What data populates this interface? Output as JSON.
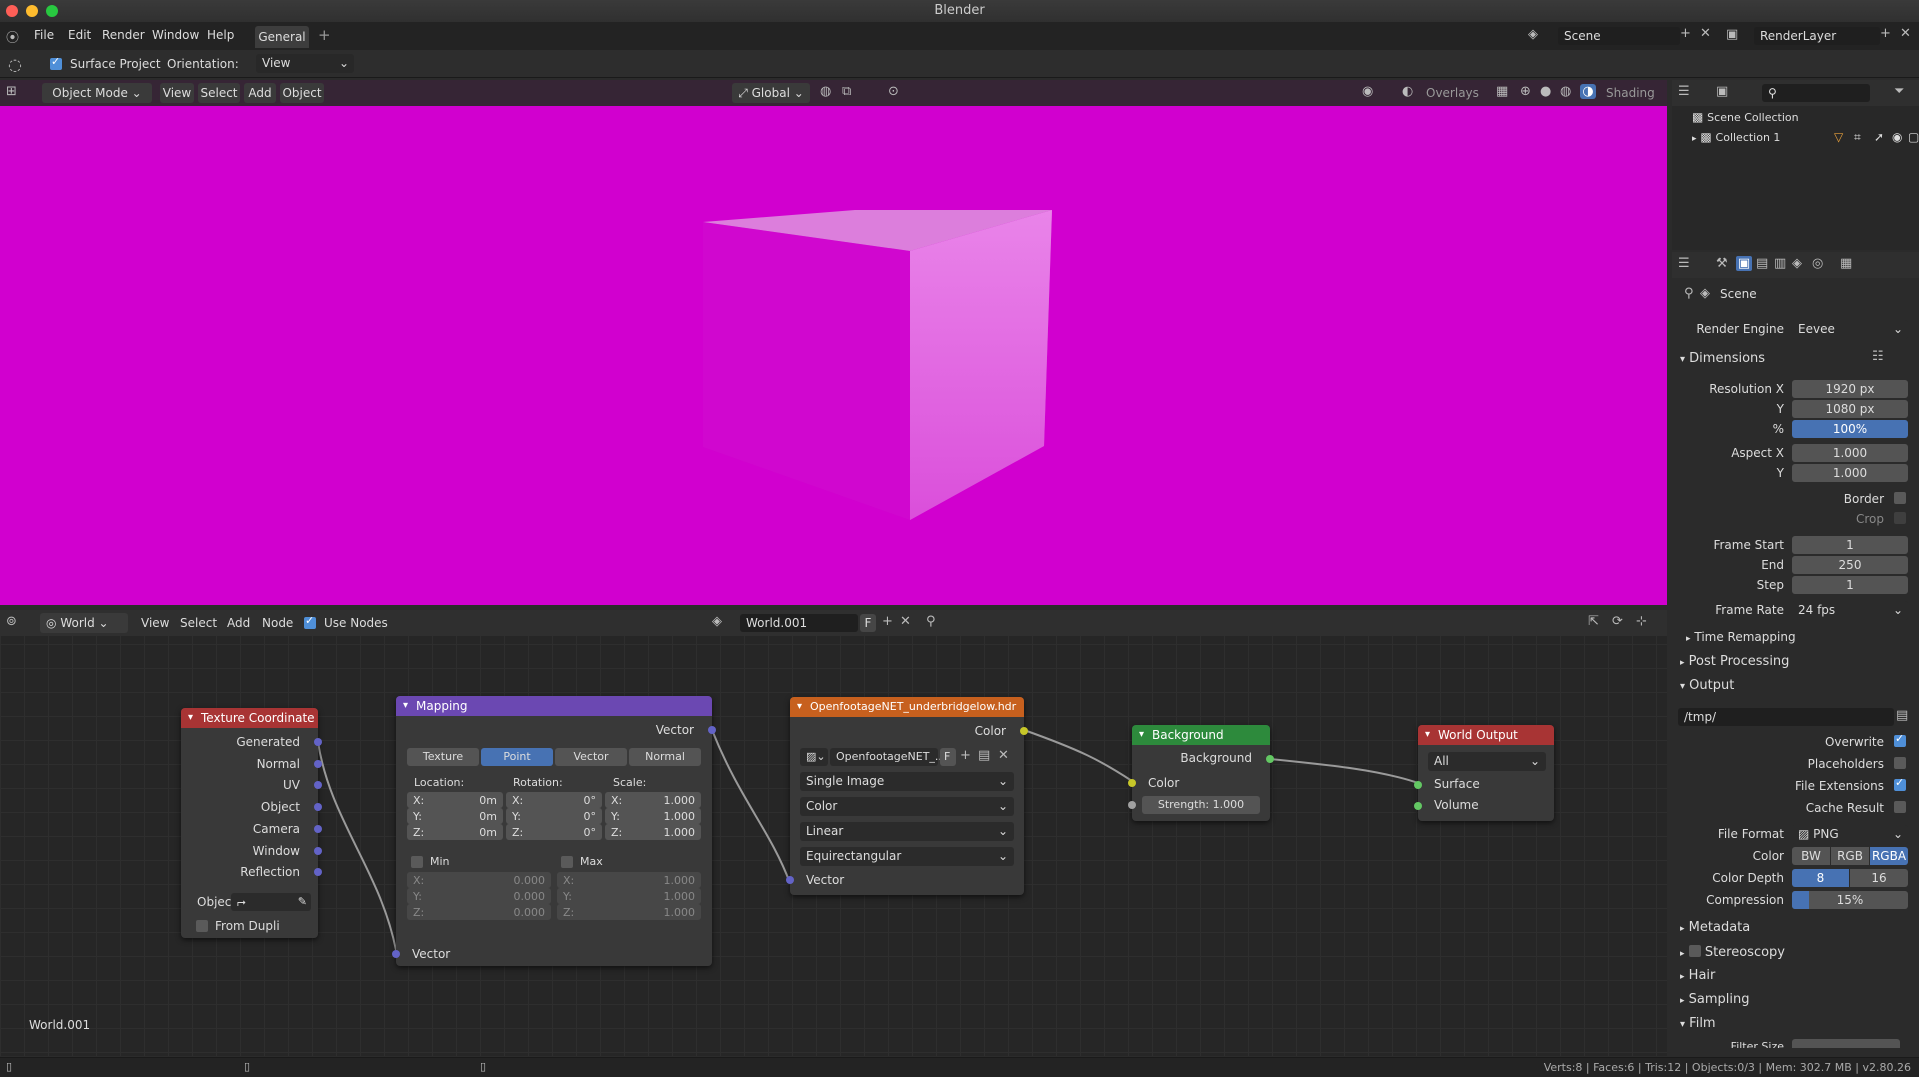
{
  "window": {
    "title": "Blender"
  },
  "menu": {
    "items": [
      "File",
      "Edit",
      "Render",
      "Window",
      "Help"
    ],
    "workspace_tab": "General",
    "add_tab": "+",
    "scene_name": "Scene",
    "layer_name": "RenderLayer"
  },
  "tool_options": {
    "surface_project": "Surface Project",
    "orientation_label": "Orientation:",
    "orientation_value": "View"
  },
  "viewport_header": {
    "mode": "Object Mode",
    "menus": [
      "View",
      "Select",
      "Add",
      "Object"
    ],
    "transform": "Global",
    "overlays": "Overlays",
    "shading": "Shading"
  },
  "node_header": {
    "type": "World",
    "menus": [
      "View",
      "Select",
      "Add",
      "Node"
    ],
    "use_nodes": "Use Nodes",
    "world_name": "World.001",
    "fake_user": "F"
  },
  "node_editor": {
    "world_label": "World.001"
  },
  "nodes": {
    "texcoord": {
      "title": "Texture Coordinate",
      "outputs": [
        "Generated",
        "Normal",
        "UV",
        "Object",
        "Camera",
        "Window",
        "Reflection"
      ],
      "object_label": "Objec",
      "from_dupli": "From Dupli"
    },
    "mapping": {
      "title": "Mapping",
      "output": "Vector",
      "tabs": [
        "Texture",
        "Point",
        "Vector",
        "Normal"
      ],
      "location_label": "Location:",
      "rotation_label": "Rotation:",
      "scale_label": "Scale:",
      "location": [
        {
          "axis": "X:",
          "value": "0m"
        },
        {
          "axis": "Y:",
          "value": "0m"
        },
        {
          "axis": "Z:",
          "value": "0m"
        }
      ],
      "rotation": [
        {
          "axis": "X:",
          "value": "0°"
        },
        {
          "axis": "Y:",
          "value": "0°"
        },
        {
          "axis": "Z:",
          "value": "0°"
        }
      ],
      "scale": [
        {
          "axis": "X:",
          "value": "1.000"
        },
        {
          "axis": "Y:",
          "value": "1.000"
        },
        {
          "axis": "Z:",
          "value": "1.000"
        }
      ],
      "min_label": "Min",
      "max_label": "Max",
      "min": [
        {
          "axis": "X:",
          "value": "0.000"
        },
        {
          "axis": "Y:",
          "value": "0.000"
        },
        {
          "axis": "Z:",
          "value": "0.000"
        }
      ],
      "max": [
        {
          "axis": "X:",
          "value": "1.000"
        },
        {
          "axis": "Y:",
          "value": "1.000"
        },
        {
          "axis": "Z:",
          "value": "1.000"
        }
      ],
      "input": "Vector"
    },
    "envtex": {
      "title": "OpenfootageNET_underbridgelow.hdr",
      "output": "Color",
      "image_name": "OpenfootageNET_...",
      "fake": "F",
      "source": "Single Image",
      "colorspace": "Color",
      "interpolation": "Linear",
      "projection": "Equirectangular",
      "input": "Vector"
    },
    "background": {
      "title": "Background",
      "output": "Background",
      "color_input": "Color",
      "strength_label": "Strength:",
      "strength_value": "1.000"
    },
    "worldout": {
      "title": "World Output",
      "target": "All",
      "surface": "Surface",
      "volume": "Volume"
    }
  },
  "outliner": {
    "scene_collection": "Scene Collection",
    "collection": "Collection 1"
  },
  "properties": {
    "context": "Scene",
    "render_engine_label": "Render Engine",
    "render_engine": "Eevee",
    "dimensions": "Dimensions",
    "res_x_label": "Resolution X",
    "res_x": "1920 px",
    "res_y_label": "Y",
    "res_y": "1080 px",
    "pct_label": "%",
    "pct": "100%",
    "aspect_x_label": "Aspect X",
    "aspect_x": "1.000",
    "aspect_y_label": "Y",
    "aspect_y": "1.000",
    "border": "Border",
    "crop": "Crop",
    "frame_start_label": "Frame Start",
    "frame_start": "1",
    "end_label": "End",
    "end": "250",
    "step_label": "Step",
    "step": "1",
    "frame_rate_label": "Frame Rate",
    "frame_rate": "24 fps",
    "time_remapping": "Time Remapping",
    "post_processing": "Post Processing",
    "output": "Output",
    "output_path": "/tmp/",
    "overwrite": "Overwrite",
    "placeholders": "Placeholders",
    "file_extensions": "File Extensions",
    "cache_result": "Cache Result",
    "file_format_label": "File Format",
    "file_format": "PNG",
    "color_label": "Color",
    "color_modes": [
      "BW",
      "RGB",
      "RGBA"
    ],
    "color_depth_label": "Color Depth",
    "depths": [
      "8",
      "16"
    ],
    "compression_label": "Compression",
    "compression": "15%",
    "compression_fraction": 0.15,
    "metadata": "Metadata",
    "stereoscopy": "Stereoscopy",
    "hair": "Hair",
    "sampling": "Sampling",
    "film": "Film",
    "filter_size": "Filter Size"
  },
  "status": {
    "text": "Verts:8 | Faces:6 | Tris:12 | Objects:0/3 | Mem: 302.7 MB | v2.80.26"
  },
  "colors": {
    "viewport_bg": "#d100cf",
    "selected": "#4772b3",
    "vector_socket": "#6363c7",
    "color_socket": "#c7c729",
    "shader_socket": "#63c763"
  }
}
